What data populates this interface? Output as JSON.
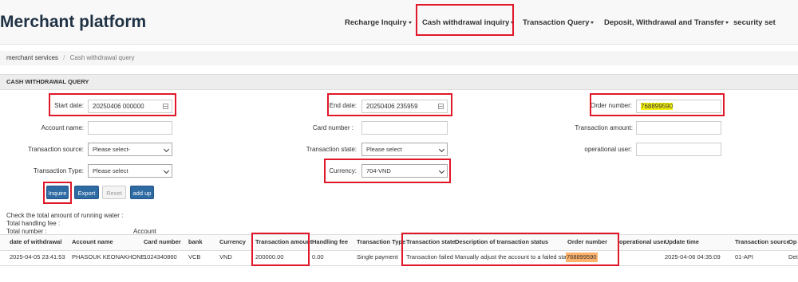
{
  "header": {
    "brand": "Merchant platform",
    "nav": [
      {
        "label": "Recharge Inquiry"
      },
      {
        "label": "Cash withdrawal inquiry"
      },
      {
        "label": "Transaction Query"
      },
      {
        "label": "Deposit, Withdrawal and Transfer"
      },
      {
        "label": "security set"
      }
    ]
  },
  "breadcrumb": {
    "home": "merchant services",
    "sep": "/",
    "current": "Cash withdrawal query"
  },
  "section_title": "CASH WITHDRAWAL QUERY",
  "form": {
    "start_date_label": "Start date:",
    "start_date_value": "20250406 000000",
    "end_date_label": "End date:",
    "end_date_value": "20250406 235959",
    "order_number_label": "Order number:",
    "order_number_value": "768899590",
    "account_name_label": "Account name:",
    "card_number_label": "Card number :",
    "transaction_amount_label": "Transaction amount:",
    "transaction_source_label": "Transaction source:",
    "transaction_source_value": "Please select-",
    "transaction_state_label": "Transaction state:",
    "transaction_state_value": "Please select",
    "operational_user_label": "operational user:",
    "transaction_type_label": "Transaction Type:",
    "transaction_type_value": "Please select",
    "currency_label": "Currency:",
    "currency_value": "704-VND"
  },
  "buttons": {
    "inquire": "Inquire",
    "export": "Export",
    "reset": "Reset",
    "add_up": "add up"
  },
  "summary": {
    "running_water": "Check the total amount of running water :",
    "handling_fee": "Total handling fee :",
    "total_number": "Total number :",
    "account": "Account"
  },
  "table": {
    "headers": [
      "date of withdrawal",
      "Account name",
      "Card number",
      "bank",
      "Currency",
      "Transaction amount",
      "Handling fee",
      "Transaction Type",
      "Transaction state",
      "Description of transaction status",
      "Order number",
      "operational user",
      "Update time",
      "Transaction source",
      "Op"
    ],
    "rows": [
      [
        "2025-04-05 23:41:53",
        "PHASOUK KEONAKHONE",
        "1024340860",
        "VCB",
        "VND",
        "200000.00",
        "0.00",
        "Single payment",
        "Transaction failed",
        "Manually adjust the account to a failed state",
        "768899590",
        "",
        "2025-04-06 04:35:09",
        "01-API",
        "Deta"
      ]
    ]
  },
  "colors": {
    "highlight_box": "#e0182a",
    "primary_button": "#2f6ba3",
    "text_highlight": "#f6f210"
  }
}
